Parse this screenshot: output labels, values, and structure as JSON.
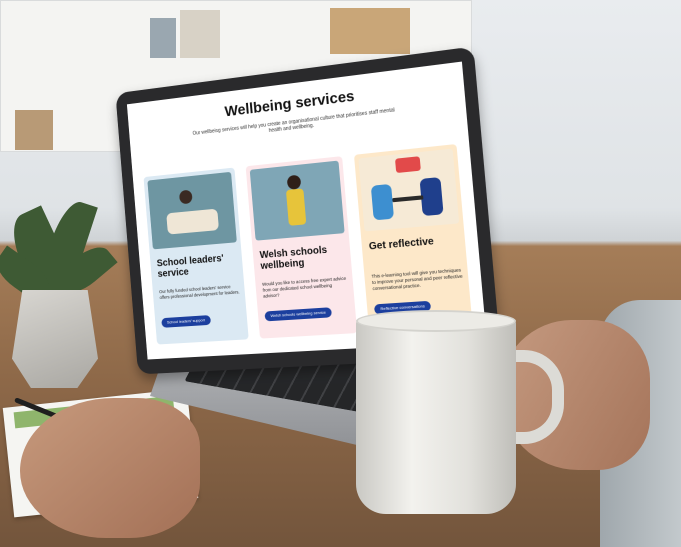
{
  "screen": {
    "title": "Wellbeing services",
    "subtitle": "Our wellbeing services will help you create an organisational culture that prioritises staff mental health and wellbeing.",
    "cards": [
      {
        "title": "School leaders' service",
        "body": "Our fully funded school leaders' service offers professional development for leaders.",
        "button": "School leaders' support",
        "bg": "#dbe9f3",
        "image_bg": "#6e96a2"
      },
      {
        "title": "Welsh schools wellbeing",
        "body": "Would you like to access free expert advice from our dedicated school wellbeing advisor?",
        "button": "Welsh schools wellbeing service",
        "bg": "#fce7ea",
        "image_bg": "#7fa6b6"
      },
      {
        "title": "Get reflective",
        "body": "This e-learning tool will give you techniques to improve your personal and peer reflective conversational practice.",
        "button": "Reflective conversations",
        "bg": "#fde8c9",
        "image_bg": "#f6ead6"
      }
    ]
  },
  "colors": {
    "button": "#1c3f9e",
    "wood": "#8d6848"
  }
}
